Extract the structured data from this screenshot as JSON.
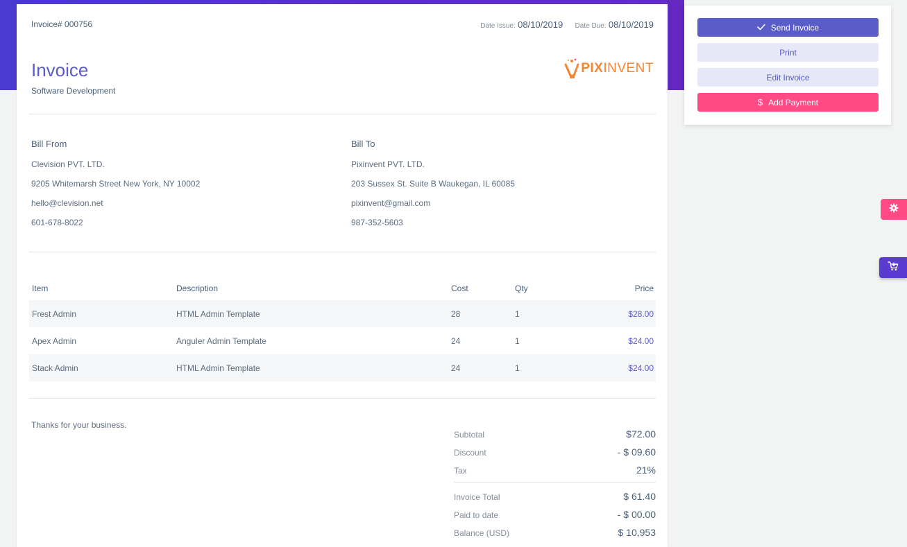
{
  "colors": {
    "accent": "#5a5cc7",
    "header_band": "#5a2fc4",
    "logo_orange": "#f58535",
    "add_payment": "#ff4a85",
    "light_button_bg": "#e7e8f7"
  },
  "invoice": {
    "number_label": "Invoice#",
    "number": "000756",
    "date_issue_label": "Date Issue:",
    "date_issue": "08/10/2019",
    "date_due_label": "Date Due:",
    "date_due": "08/10/2019",
    "title": "Invoice",
    "subtitle": "Software Development",
    "logo": {
      "text_bold": "PIX",
      "text_thin": "INVENT",
      "icon": "bulb-logo-icon"
    }
  },
  "bill_from": {
    "heading": "Bill From",
    "company": "Clevision PVT. LTD.",
    "address": "9205 Whitemarsh Street New York, NY 10002",
    "email": "hello@clevision.net",
    "phone": "601-678-8022"
  },
  "bill_to": {
    "heading": "Bill To",
    "company": "Pixinvent PVT. LTD.",
    "address": "203 Sussex St. Suite B Waukegan, IL 60085",
    "email": "pixinvent@gmail.com",
    "phone": "987-352-5603"
  },
  "items_table": {
    "headers": {
      "item": "Item",
      "description": "Description",
      "cost": "Cost",
      "qty": "Qty",
      "price": "Price"
    },
    "rows": [
      {
        "item": "Frest Admin",
        "description": "HTML Admin Template",
        "cost": "28",
        "qty": "1",
        "price": "$28.00"
      },
      {
        "item": "Apex Admin",
        "description": "Anguler Admin Template",
        "cost": "24",
        "qty": "1",
        "price": "$24.00"
      },
      {
        "item": "Stack Admin",
        "description": "HTML Admin Template",
        "cost": "24",
        "qty": "1",
        "price": "$24.00"
      }
    ]
  },
  "footer": {
    "thanks": "Thanks for your business."
  },
  "totals": {
    "subtotal_label": "Subtotal",
    "subtotal": "$72.00",
    "discount_label": "Discount",
    "discount": "- $ 09.60",
    "tax_label": "Tax",
    "tax": "21%",
    "invoice_total_label": "Invoice Total",
    "invoice_total": "$ 61.40",
    "paid_label": "Paid to date",
    "paid": "- $ 00.00",
    "balance_label": "Balance (USD)",
    "balance": "$ 10,953"
  },
  "actions": {
    "send": {
      "label": "Send Invoice",
      "icon": "check-icon"
    },
    "print": {
      "label": "Print"
    },
    "edit": {
      "label": "Edit Invoice"
    },
    "add_payment": {
      "label": "Add Payment",
      "icon": "dollar-icon"
    }
  },
  "floating": {
    "settings_icon": "gear-icon",
    "cart_icon": "cart-icon"
  }
}
